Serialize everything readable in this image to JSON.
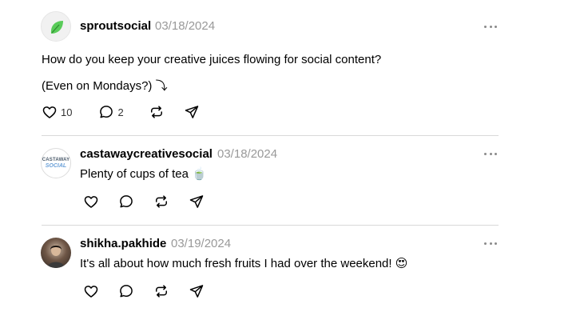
{
  "posts": [
    {
      "username": "sproutsocial",
      "date": "03/18/2024",
      "lines": [
        "How do you keep your creative juices flowing for social content?",
        "(Even on Mondays?) ⤵"
      ],
      "likes": "10",
      "replies": "2",
      "avatar_icon": "leaf-logo-icon",
      "accent": "#59cb59"
    },
    {
      "username": "castawaycreativesocial",
      "date": "03/18/2024",
      "lines": [
        "Plenty of cups of tea 🍵"
      ],
      "avatar_logo": {
        "line1": "CASTAWAY",
        "line2": "SOCIAL"
      }
    },
    {
      "username": "shikha.pakhide",
      "date": "03/19/2024",
      "lines": [
        "It's all about how much fresh fruits I had over the weekend! 😍"
      ]
    }
  ],
  "icons": [
    "heart-icon",
    "comment-icon",
    "repost-icon",
    "share-icon",
    "more-icon"
  ]
}
